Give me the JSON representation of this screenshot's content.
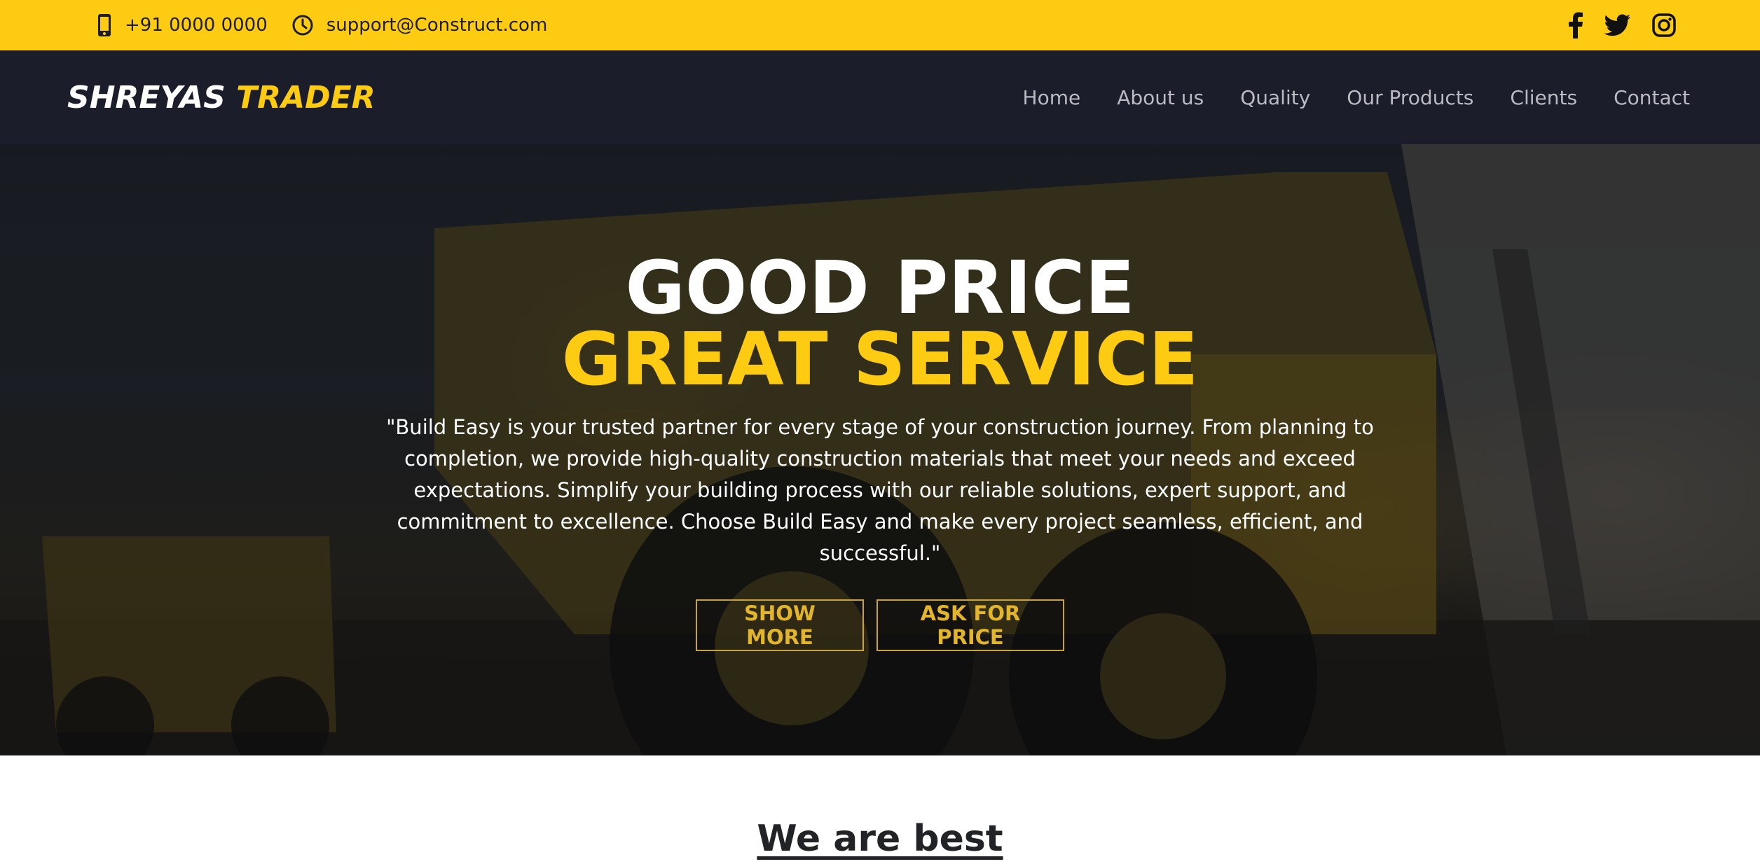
{
  "topbar": {
    "phone": "+91 0000 0000",
    "email": "support@Construct.com",
    "phone_icon": "mobile-phone-icon",
    "email_icon": "clock-icon",
    "socials": [
      "facebook-icon",
      "twitter-icon",
      "instagram-icon"
    ],
    "bg_color": "#fdcb12"
  },
  "nav": {
    "logo_part1": "SHREYAS",
    "logo_part2": "TRADER",
    "items": [
      {
        "label": "Home"
      },
      {
        "label": "About us"
      },
      {
        "label": "Quality"
      },
      {
        "label": "Our Products"
      },
      {
        "label": "Clients"
      },
      {
        "label": "Contact"
      }
    ],
    "bg_color": "#1c1d2a"
  },
  "hero": {
    "title_line1": "GOOD PRICE",
    "title_line2": "GREAT SERVICE",
    "description": "\"Build Easy is your trusted partner for every stage of your construction journey. From planning to completion, we provide high-quality construction materials that meet your needs and exceed expectations. Simplify your building process with our reliable solutions, expert support, and commitment to excellence. Choose Build Easy and make every project seamless, efficient, and successful.\"",
    "button_show_more": "SHOW MORE",
    "button_ask_price": "ASK FOR PRICE",
    "accent_color": "#fdcb12"
  },
  "section": {
    "heading": "We are best"
  }
}
